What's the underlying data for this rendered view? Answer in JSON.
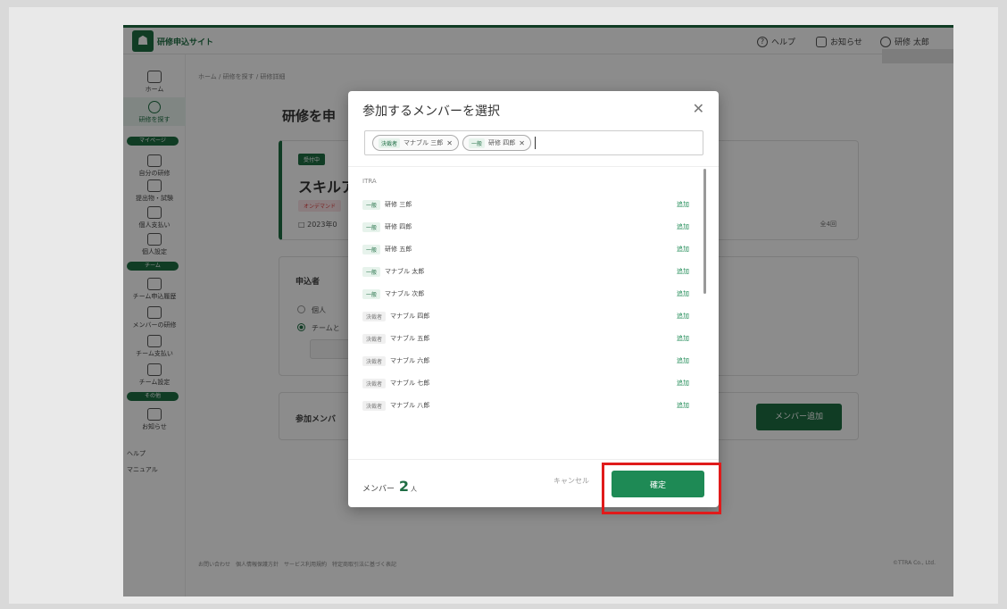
{
  "header": {
    "logo_text": "研修申込サイト",
    "help": "ヘルプ",
    "notifications": "お知らせ",
    "user": "研修 太郎"
  },
  "sidebar": {
    "items": [
      {
        "label": "ホーム"
      },
      {
        "label": "研修を探す"
      },
      {
        "label": "自分の研修"
      },
      {
        "label": "提出物・試験"
      },
      {
        "label": "個人支払い"
      },
      {
        "label": "個人設定"
      },
      {
        "label": "チーム申込履歴"
      },
      {
        "label": "メンバーの研修"
      },
      {
        "label": "チーム支払い"
      },
      {
        "label": "チーム設定"
      },
      {
        "label": "お知らせ"
      },
      {
        "label": "ヘルプ"
      },
      {
        "label": "マニュアル"
      }
    ],
    "pills": [
      "マイページ",
      "チーム",
      "その他"
    ]
  },
  "main": {
    "breadcrumb": "ホーム / 研修を探す / 研修詳細",
    "page_title": "研修を申",
    "card1": {
      "status": "受付中",
      "title": "スキルア",
      "tag": "オンデマンド",
      "date": "2023年0",
      "count": "全4回"
    },
    "card2": {
      "label": "申込者",
      "option1": "個人",
      "option2": "チームと"
    },
    "card3": {
      "label": "参加メンバ",
      "add_button": "メンバー追加"
    },
    "footer_links": "お問い合わせ　個人情報保護方針　サービス利用規約　特定商取引法に基づく表記",
    "copyright": "©TTRA Co., Ltd."
  },
  "modal": {
    "title": "参加するメンバーを選択",
    "chips": [
      {
        "role": "決裁者",
        "name": "マナブル 三郎"
      },
      {
        "role": "一般",
        "name": "研修 四郎"
      }
    ],
    "group_label": "ITRA",
    "members": [
      {
        "role": "一般",
        "role_type": "general",
        "name": "研修 三郎",
        "action": "追加"
      },
      {
        "role": "一般",
        "role_type": "general",
        "name": "研修 四郎",
        "action": "追加"
      },
      {
        "role": "一般",
        "role_type": "general",
        "name": "研修 五郎",
        "action": "追加"
      },
      {
        "role": "一般",
        "role_type": "general",
        "name": "マナブル 太郎",
        "action": "追加"
      },
      {
        "role": "一般",
        "role_type": "general",
        "name": "マナブル 次郎",
        "action": "追加"
      },
      {
        "role": "決裁者",
        "role_type": "manager",
        "name": "マナブル 四郎",
        "action": "追加"
      },
      {
        "role": "決裁者",
        "role_type": "manager",
        "name": "マナブル 五郎",
        "action": "追加"
      },
      {
        "role": "決裁者",
        "role_type": "manager",
        "name": "マナブル 六郎",
        "action": "追加"
      },
      {
        "role": "決裁者",
        "role_type": "manager",
        "name": "マナブル 七郎",
        "action": "追加"
      },
      {
        "role": "決裁者",
        "role_type": "manager",
        "name": "マナブル 八郎",
        "action": "追加"
      }
    ],
    "footer": {
      "member_label": "メンバー",
      "member_count": "2",
      "member_unit": "人",
      "cancel": "キャンセル",
      "confirm": "確定"
    }
  },
  "colors": {
    "brand": "#1e6d43",
    "highlight": "#e01b1b"
  }
}
